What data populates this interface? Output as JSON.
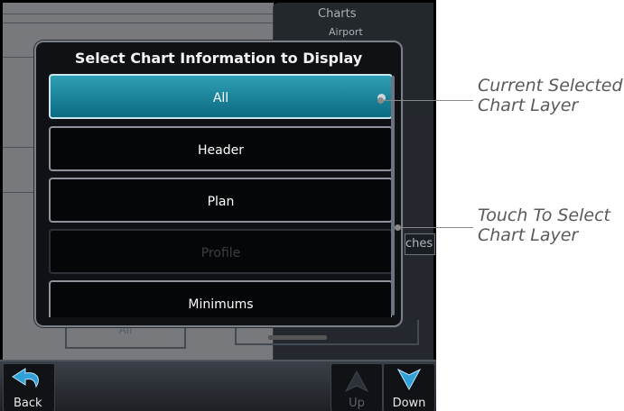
{
  "dialog": {
    "title": "Select Chart Information to Display",
    "options": [
      {
        "label": "All",
        "state": "selected"
      },
      {
        "label": "Header",
        "state": "normal"
      },
      {
        "label": "Plan",
        "state": "normal"
      },
      {
        "label": "Profile",
        "state": "disabled"
      },
      {
        "label": "Minimums",
        "state": "normal"
      }
    ]
  },
  "background": {
    "panel_title": "Charts",
    "panel_subtitle": "Airport",
    "ghost_tab_fragment": "ches",
    "ghost_button_label": "All"
  },
  "bottom_bar": {
    "back_label": "Back",
    "up_label": "Up",
    "down_label": "Down"
  },
  "annotations": {
    "current_selected": [
      "Current Selected",
      "Chart Layer"
    ],
    "touch_to_select": [
      "Touch To Select",
      "Chart Layer"
    ]
  },
  "colors": {
    "selected_gradient_top": "#2f9fb4",
    "selected_gradient_bottom": "#0b6a81",
    "button_border": "#8c939c",
    "callout_text": "#5a5a5a"
  }
}
